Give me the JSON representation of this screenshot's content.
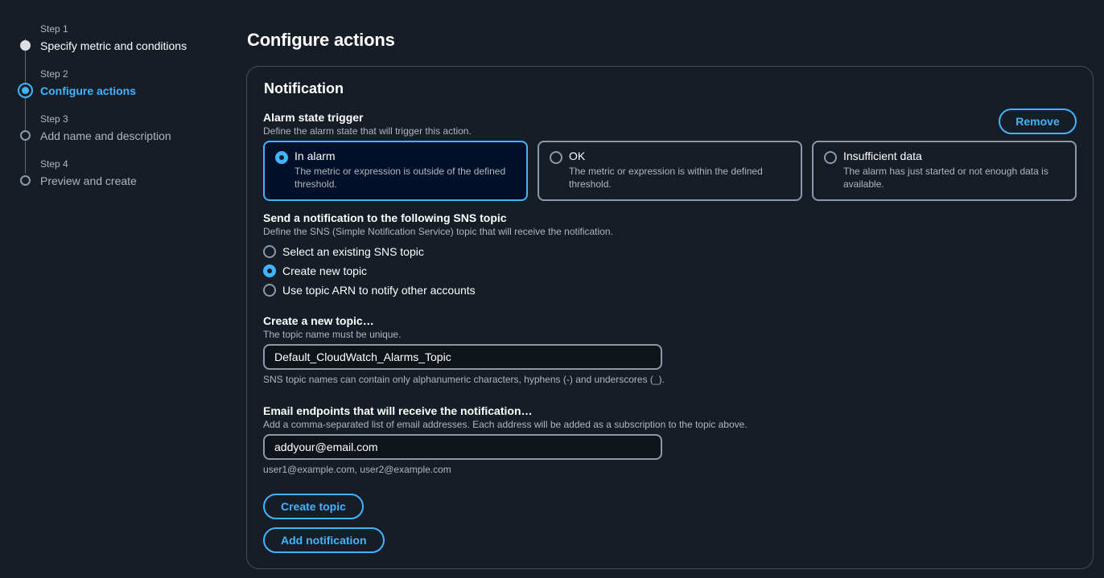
{
  "stepper": {
    "steps": [
      {
        "number": "Step 1",
        "title": "Specify metric and conditions",
        "state": "done"
      },
      {
        "number": "Step 2",
        "title": "Configure actions",
        "state": "current"
      },
      {
        "number": "Step 3",
        "title": "Add name and description",
        "state": "future"
      },
      {
        "number": "Step 4",
        "title": "Preview and create",
        "state": "future"
      }
    ]
  },
  "page": {
    "title": "Configure actions"
  },
  "notification": {
    "title": "Notification",
    "remove_label": "Remove",
    "alarm_trigger": {
      "label": "Alarm state trigger",
      "description": "Define the alarm state that will trigger this action.",
      "options": [
        {
          "title": "In alarm",
          "description": "The metric or expression is outside of the defined threshold.",
          "selected": true
        },
        {
          "title": "OK",
          "description": "The metric or expression is within the defined threshold.",
          "selected": false
        },
        {
          "title": "Insufficient data",
          "description": "The alarm has just started or not enough data is available.",
          "selected": false
        }
      ]
    },
    "sns": {
      "label": "Send a notification to the following SNS topic",
      "description": "Define the SNS (Simple Notification Service) topic that will receive the notification.",
      "options": [
        {
          "label": "Select an existing SNS topic",
          "selected": false
        },
        {
          "label": "Create new topic",
          "selected": true
        },
        {
          "label": "Use topic ARN to notify other accounts",
          "selected": false
        }
      ]
    },
    "new_topic": {
      "label": "Create a new topic…",
      "description": "The topic name must be unique.",
      "value": "Default_CloudWatch_Alarms_Topic",
      "hint": "SNS topic names can contain only alphanumeric characters, hyphens (-) and underscores (_)."
    },
    "email": {
      "label": "Email endpoints that will receive the notification…",
      "description": "Add a comma-separated list of email addresses. Each address will be added as a subscription to the topic above.",
      "value": "addyour@email.com",
      "hint": "user1@example.com, user2@example.com"
    },
    "create_topic_label": "Create topic",
    "add_notification_label": "Add notification"
  },
  "colors": {
    "accent": "#42b4ff",
    "background": "#161d26",
    "border": "#8d99a8"
  }
}
